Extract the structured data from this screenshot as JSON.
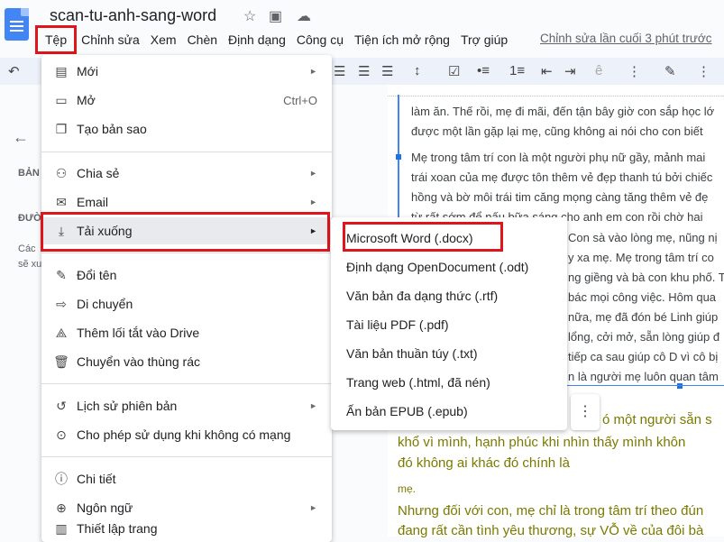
{
  "header": {
    "doc_title": "scan-tu-anh-sang-word",
    "menus": [
      "Tệp",
      "Chỉnh sửa",
      "Xem",
      "Chèn",
      "Định dạng",
      "Công cụ",
      "Tiện ích mở rộng",
      "Trợ giúp"
    ],
    "last_edit": "Chỉnh sửa lần cuối 3 phút trước"
  },
  "left_panel": {
    "heading": "BẢN",
    "subheading": "ĐƯỜ",
    "line1": "Các",
    "line2": "sẽ xu"
  },
  "file_menu": {
    "items": [
      {
        "label": "Mới",
        "icon": "new-doc-icon",
        "glyph": "▤",
        "arrow": "►"
      },
      {
        "label": "Mở",
        "icon": "folder-icon",
        "glyph": "▭",
        "shortcut": "Ctrl+O"
      },
      {
        "label": "Tạo bản sao",
        "icon": "copy-icon",
        "glyph": "❐"
      },
      {
        "label": "Chia sẻ",
        "icon": "person-add-icon",
        "glyph": "⚇",
        "arrow": "►"
      },
      {
        "label": "Email",
        "icon": "email-icon",
        "glyph": "✉",
        "arrow": "►"
      },
      {
        "label": "Tải xuống",
        "icon": "download-icon",
        "glyph": "⤓",
        "arrow": "►"
      },
      {
        "label": "Đổi tên",
        "icon": "rename-icon",
        "glyph": "✎"
      },
      {
        "label": "Di chuyển",
        "icon": "move-folder-icon",
        "glyph": "⇨"
      },
      {
        "label": "Thêm lối tắt vào Drive",
        "icon": "drive-shortcut-icon",
        "glyph": "⟁"
      },
      {
        "label": "Chuyển vào thùng rác",
        "icon": "trash-icon",
        "glyph": "🗑"
      },
      {
        "label": "Lịch sử phiên bản",
        "icon": "history-icon",
        "glyph": "↺",
        "arrow": "►"
      },
      {
        "label": "Cho phép sử dụng khi không có mạng",
        "icon": "offline-icon",
        "glyph": "⊙"
      },
      {
        "label": "Chi tiết",
        "icon": "info-icon",
        "glyph": "ⓘ"
      },
      {
        "label": "Ngôn ngữ",
        "icon": "globe-icon",
        "glyph": "⊕",
        "arrow": "►"
      },
      {
        "label": "Thiết lập trang",
        "icon": "page-setup-icon",
        "glyph": "▥"
      }
    ]
  },
  "download_submenu": {
    "items": [
      "Microsoft Word (.docx)",
      "Định dạng OpenDocument (.odt)",
      "Văn bản đa dạng thức (.rtf)",
      "Tài liệu PDF (.pdf)",
      "Văn bản thuần túy (.txt)",
      "Trang web (.html, đã nén)",
      "Ấn bản EPUB (.epub)"
    ]
  },
  "document": {
    "lines": [
      "làm ăn. Thế rồi, mẹ đi mãi, đến tận bây giờ con sắp học lớ",
      "được một lần gặp lại mẹ, cũng không ai nói cho con biết",
      "Mẹ trong tâm trí con là một người phụ nữ gầy, mảnh mai",
      "trái xoan của mẹ được tôn thêm vẻ đẹp thanh tú bởi chiếc",
      "hồng và bờ môi trái tim căng mọng càng tăng thêm vẻ đẹ",
      "từ rất sớm để nấu bữa sáng cho anh em con rồi chờ hai",
      "Con sà vào lòng mẹ, nũng nị",
      "y xa mẹ. Mẹ trong tâm trí co",
      "ng giềng và bà con khu phố. T",
      "bác mọi công việc. Hôm qua",
      "nữa, mẹ đã đón bé Linh giúp",
      "lổng, cởi mở, sẵn lòng giúp đ",
      "tiếp ca sau giúp cô D vì cô bị",
      "n là người mẹ luôn quan tâm"
    ],
    "olive_lines": [
      "ó một người sẵn s",
      "khổ vì mình, hạnh phúc khi nhìn thấy mình khôn",
      "đó không ai khác đó chính là",
      "mẹ.",
      "Nhưng đối với con, mẹ chỉ là trong tâm trí theo đún",
      "đang rất cần tình yêu thương, sự VỖ về của đôi bà"
    ]
  },
  "colors": {
    "highlight_border": "#e0151b",
    "selection_blue": "#4285f4",
    "olive_text": "#7a7a00"
  }
}
